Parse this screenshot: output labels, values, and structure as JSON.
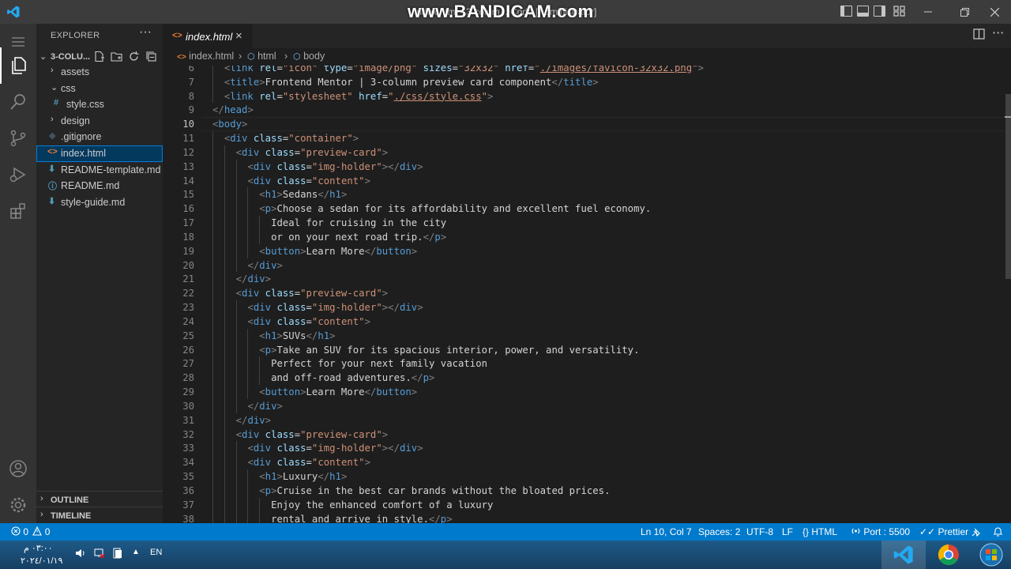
{
  "window": {
    "title": "index.html - 3-colum... Code [Administrator]",
    "watermark": "www.BANDICAM.com"
  },
  "sidebar": {
    "title": "EXPLORER",
    "more": "···",
    "folder": "3-COLU...",
    "items": [
      {
        "label": "assets",
        "type": "folder",
        "expanded": false
      },
      {
        "label": "css",
        "type": "folder",
        "expanded": true
      },
      {
        "label": "style.css",
        "type": "css",
        "icon": "#"
      },
      {
        "label": "design",
        "type": "folder",
        "expanded": false
      },
      {
        "label": ".gitignore",
        "type": "git",
        "icon": "◆"
      },
      {
        "label": "index.html",
        "type": "html",
        "icon": "<>",
        "selected": true
      },
      {
        "label": "README-template.md",
        "type": "md",
        "icon": "⬇"
      },
      {
        "label": "README.md",
        "type": "info",
        "icon": "ⓘ"
      },
      {
        "label": "style-guide.md",
        "type": "md",
        "icon": "⬇"
      }
    ],
    "panels": [
      "OUTLINE",
      "TIMELINE"
    ]
  },
  "editor": {
    "tab_label": "index.html",
    "tab_icon": "<>",
    "breadcrumb": [
      "index.html",
      "html",
      "body"
    ],
    "active_line": 10,
    "lines": [
      {
        "n": "6",
        "indent": 2,
        "tokens": [
          [
            "br",
            "<"
          ],
          [
            "tag",
            "link"
          ],
          [
            "txt",
            " "
          ],
          [
            "attr",
            "rel"
          ],
          [
            "txt",
            "="
          ],
          [
            "str",
            "\"icon\""
          ],
          [
            "txt",
            " "
          ],
          [
            "attr",
            "type"
          ],
          [
            "txt",
            "="
          ],
          [
            "str",
            "\"image/png\""
          ],
          [
            "txt",
            " "
          ],
          [
            "attr",
            "sizes"
          ],
          [
            "txt",
            "="
          ],
          [
            "str",
            "\"32x32\""
          ],
          [
            "txt",
            " "
          ],
          [
            "attr",
            "href"
          ],
          [
            "txt",
            "="
          ],
          [
            "str",
            "\""
          ],
          [
            "link",
            "./images/favicon-32x32.png"
          ],
          [
            "str",
            "\""
          ],
          [
            "br",
            ">"
          ]
        ]
      },
      {
        "n": "7",
        "indent": 2,
        "tokens": [
          [
            "br",
            "<"
          ],
          [
            "tag",
            "title"
          ],
          [
            "br",
            ">"
          ],
          [
            "txt",
            "Frontend Mentor | 3-column preview card component"
          ],
          [
            "br",
            "</"
          ],
          [
            "tag",
            "title"
          ],
          [
            "br",
            ">"
          ]
        ]
      },
      {
        "n": "8",
        "indent": 2,
        "tokens": [
          [
            "br",
            "<"
          ],
          [
            "tag",
            "link"
          ],
          [
            "txt",
            " "
          ],
          [
            "attr",
            "rel"
          ],
          [
            "txt",
            "="
          ],
          [
            "str",
            "\"stylesheet\""
          ],
          [
            "txt",
            " "
          ],
          [
            "attr",
            "href"
          ],
          [
            "txt",
            "="
          ],
          [
            "str",
            "\""
          ],
          [
            "link",
            "./css/style.css"
          ],
          [
            "str",
            "\""
          ],
          [
            "br",
            ">"
          ]
        ]
      },
      {
        "n": "9",
        "indent": 1,
        "tokens": [
          [
            "br",
            "</"
          ],
          [
            "tag",
            "head"
          ],
          [
            "br",
            ">"
          ]
        ]
      },
      {
        "n": "10",
        "indent": 1,
        "tokens": [
          [
            "br",
            "<"
          ],
          [
            "tag",
            "body"
          ],
          [
            "br",
            ">"
          ]
        ]
      },
      {
        "n": "11",
        "indent": 2,
        "tokens": [
          [
            "br",
            "<"
          ],
          [
            "tag",
            "div"
          ],
          [
            "txt",
            " "
          ],
          [
            "attr",
            "class"
          ],
          [
            "txt",
            "="
          ],
          [
            "str",
            "\"container\""
          ],
          [
            "br",
            ">"
          ]
        ]
      },
      {
        "n": "12",
        "indent": 3,
        "tokens": [
          [
            "br",
            "<"
          ],
          [
            "tag",
            "div"
          ],
          [
            "txt",
            " "
          ],
          [
            "attr",
            "class"
          ],
          [
            "txt",
            "="
          ],
          [
            "str",
            "\"preview-card\""
          ],
          [
            "br",
            ">"
          ]
        ]
      },
      {
        "n": "13",
        "indent": 4,
        "tokens": [
          [
            "br",
            "<"
          ],
          [
            "tag",
            "div"
          ],
          [
            "txt",
            " "
          ],
          [
            "attr",
            "class"
          ],
          [
            "txt",
            "="
          ],
          [
            "str",
            "\"img-holder\""
          ],
          [
            "br",
            "></"
          ],
          [
            "tag",
            "div"
          ],
          [
            "br",
            ">"
          ]
        ]
      },
      {
        "n": "14",
        "indent": 4,
        "tokens": [
          [
            "br",
            "<"
          ],
          [
            "tag",
            "div"
          ],
          [
            "txt",
            " "
          ],
          [
            "attr",
            "class"
          ],
          [
            "txt",
            "="
          ],
          [
            "str",
            "\"content\""
          ],
          [
            "br",
            ">"
          ]
        ]
      },
      {
        "n": "15",
        "indent": 5,
        "tokens": [
          [
            "br",
            "<"
          ],
          [
            "tag",
            "h1"
          ],
          [
            "br",
            ">"
          ],
          [
            "txt",
            "Sedans"
          ],
          [
            "br",
            "</"
          ],
          [
            "tag",
            "h1"
          ],
          [
            "br",
            ">"
          ]
        ]
      },
      {
        "n": "16",
        "indent": 5,
        "tokens": [
          [
            "br",
            "<"
          ],
          [
            "tag",
            "p"
          ],
          [
            "br",
            ">"
          ],
          [
            "txt",
            "Choose a sedan for its affordability and excellent fuel economy."
          ]
        ]
      },
      {
        "n": "17",
        "indent": 6,
        "tokens": [
          [
            "txt",
            "Ideal for cruising in the city"
          ]
        ]
      },
      {
        "n": "18",
        "indent": 6,
        "tokens": [
          [
            "txt",
            "or on your next road trip."
          ],
          [
            "br",
            "</"
          ],
          [
            "tag",
            "p"
          ],
          [
            "br",
            ">"
          ]
        ]
      },
      {
        "n": "19",
        "indent": 5,
        "tokens": [
          [
            "br",
            "<"
          ],
          [
            "tag",
            "button"
          ],
          [
            "br",
            ">"
          ],
          [
            "txt",
            "Learn More"
          ],
          [
            "br",
            "</"
          ],
          [
            "tag",
            "button"
          ],
          [
            "br",
            ">"
          ]
        ]
      },
      {
        "n": "20",
        "indent": 4,
        "tokens": [
          [
            "br",
            "</"
          ],
          [
            "tag",
            "div"
          ],
          [
            "br",
            ">"
          ]
        ]
      },
      {
        "n": "21",
        "indent": 3,
        "tokens": [
          [
            "br",
            "</"
          ],
          [
            "tag",
            "div"
          ],
          [
            "br",
            ">"
          ]
        ]
      },
      {
        "n": "22",
        "indent": 3,
        "tokens": [
          [
            "br",
            "<"
          ],
          [
            "tag",
            "div"
          ],
          [
            "txt",
            " "
          ],
          [
            "attr",
            "class"
          ],
          [
            "txt",
            "="
          ],
          [
            "str",
            "\"preview-card\""
          ],
          [
            "br",
            ">"
          ]
        ]
      },
      {
        "n": "23",
        "indent": 4,
        "tokens": [
          [
            "br",
            "<"
          ],
          [
            "tag",
            "div"
          ],
          [
            "txt",
            " "
          ],
          [
            "attr",
            "class"
          ],
          [
            "txt",
            "="
          ],
          [
            "str",
            "\"img-holder\""
          ],
          [
            "br",
            "></"
          ],
          [
            "tag",
            "div"
          ],
          [
            "br",
            ">"
          ]
        ]
      },
      {
        "n": "24",
        "indent": 4,
        "tokens": [
          [
            "br",
            "<"
          ],
          [
            "tag",
            "div"
          ],
          [
            "txt",
            " "
          ],
          [
            "attr",
            "class"
          ],
          [
            "txt",
            "="
          ],
          [
            "str",
            "\"content\""
          ],
          [
            "br",
            ">"
          ]
        ]
      },
      {
        "n": "25",
        "indent": 5,
        "tokens": [
          [
            "br",
            "<"
          ],
          [
            "tag",
            "h1"
          ],
          [
            "br",
            ">"
          ],
          [
            "txt",
            "SUVs"
          ],
          [
            "br",
            "</"
          ],
          [
            "tag",
            "h1"
          ],
          [
            "br",
            ">"
          ]
        ]
      },
      {
        "n": "26",
        "indent": 5,
        "tokens": [
          [
            "br",
            "<"
          ],
          [
            "tag",
            "p"
          ],
          [
            "br",
            ">"
          ],
          [
            "txt",
            "Take an SUV for its spacious interior, power, and versatility."
          ]
        ]
      },
      {
        "n": "27",
        "indent": 6,
        "tokens": [
          [
            "txt",
            "Perfect for your next family vacation"
          ]
        ]
      },
      {
        "n": "28",
        "indent": 6,
        "tokens": [
          [
            "txt",
            "and off-road adventures."
          ],
          [
            "br",
            "</"
          ],
          [
            "tag",
            "p"
          ],
          [
            "br",
            ">"
          ]
        ]
      },
      {
        "n": "29",
        "indent": 5,
        "tokens": [
          [
            "br",
            "<"
          ],
          [
            "tag",
            "button"
          ],
          [
            "br",
            ">"
          ],
          [
            "txt",
            "Learn More"
          ],
          [
            "br",
            "</"
          ],
          [
            "tag",
            "button"
          ],
          [
            "br",
            ">"
          ]
        ]
      },
      {
        "n": "30",
        "indent": 4,
        "tokens": [
          [
            "br",
            "</"
          ],
          [
            "tag",
            "div"
          ],
          [
            "br",
            ">"
          ]
        ]
      },
      {
        "n": "31",
        "indent": 3,
        "tokens": [
          [
            "br",
            "</"
          ],
          [
            "tag",
            "div"
          ],
          [
            "br",
            ">"
          ]
        ]
      },
      {
        "n": "32",
        "indent": 3,
        "tokens": [
          [
            "br",
            "<"
          ],
          [
            "tag",
            "div"
          ],
          [
            "txt",
            " "
          ],
          [
            "attr",
            "class"
          ],
          [
            "txt",
            "="
          ],
          [
            "str",
            "\"preview-card\""
          ],
          [
            "br",
            ">"
          ]
        ]
      },
      {
        "n": "33",
        "indent": 4,
        "tokens": [
          [
            "br",
            "<"
          ],
          [
            "tag",
            "div"
          ],
          [
            "txt",
            " "
          ],
          [
            "attr",
            "class"
          ],
          [
            "txt",
            "="
          ],
          [
            "str",
            "\"img-holder\""
          ],
          [
            "br",
            "></"
          ],
          [
            "tag",
            "div"
          ],
          [
            "br",
            ">"
          ]
        ]
      },
      {
        "n": "34",
        "indent": 4,
        "tokens": [
          [
            "br",
            "<"
          ],
          [
            "tag",
            "div"
          ],
          [
            "txt",
            " "
          ],
          [
            "attr",
            "class"
          ],
          [
            "txt",
            "="
          ],
          [
            "str",
            "\"content\""
          ],
          [
            "br",
            ">"
          ]
        ]
      },
      {
        "n": "35",
        "indent": 5,
        "tokens": [
          [
            "br",
            "<"
          ],
          [
            "tag",
            "h1"
          ],
          [
            "br",
            ">"
          ],
          [
            "txt",
            "Luxury"
          ],
          [
            "br",
            "</"
          ],
          [
            "tag",
            "h1"
          ],
          [
            "br",
            ">"
          ]
        ]
      },
      {
        "n": "36",
        "indent": 5,
        "tokens": [
          [
            "br",
            "<"
          ],
          [
            "tag",
            "p"
          ],
          [
            "br",
            ">"
          ],
          [
            "txt",
            "Cruise in the best car brands without the bloated prices."
          ]
        ]
      },
      {
        "n": "37",
        "indent": 6,
        "tokens": [
          [
            "txt",
            "Enjoy the enhanced comfort of a luxury"
          ]
        ]
      },
      {
        "n": "38",
        "indent": 6,
        "tokens": [
          [
            "txt",
            "rental and arrive in style."
          ],
          [
            "br",
            "</"
          ],
          [
            "tag",
            "p"
          ],
          [
            "br",
            ">"
          ]
        ]
      }
    ]
  },
  "statusbar": {
    "errors": "0",
    "warnings": "0",
    "position": "Ln 10, Col 7",
    "spaces": "Spaces: 2",
    "encoding": "UTF-8",
    "eol": "LF",
    "language": "HTML",
    "port": "Port : 5500",
    "prettier": "Prettier"
  },
  "taskbar": {
    "time": "٠٣:٠٠ م",
    "date": "٢٠٢٤/٠١/١٩",
    "lang": "EN"
  },
  "colors": {
    "accent": "#007acc",
    "tag": "#569cd6",
    "attr": "#9cdcfe",
    "string": "#ce9178",
    "bracket": "#808080",
    "html_icon": "#e37933",
    "css_icon": "#519aba",
    "md_icon": "#519aba"
  }
}
